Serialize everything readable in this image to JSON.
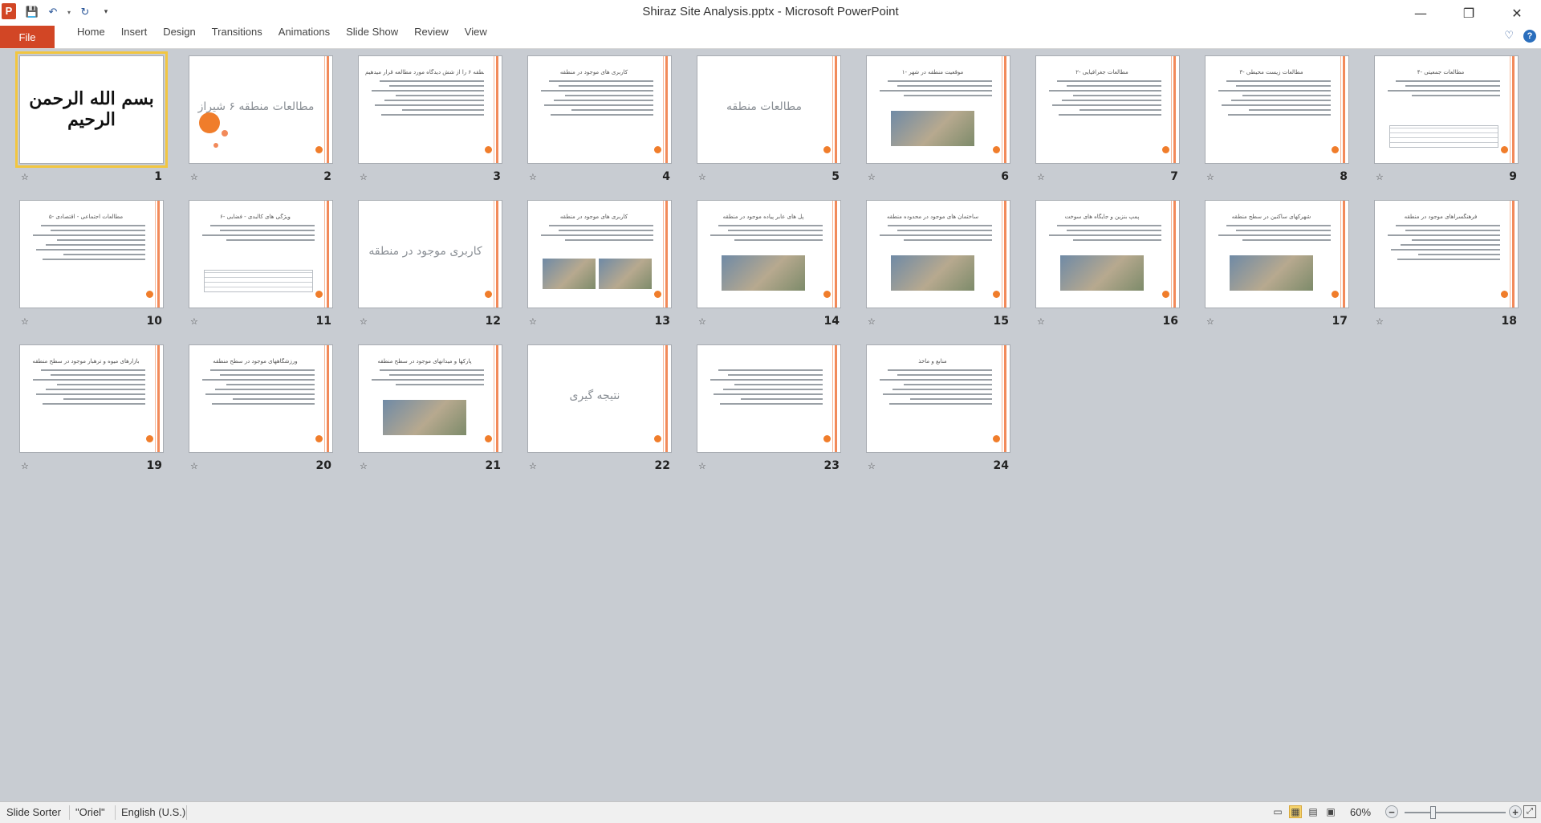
{
  "window": {
    "title": "Shiraz Site Analysis.pptx - Microsoft PowerPoint",
    "app_icon_letter": "P",
    "quick_access": [
      "save-icon",
      "undo-icon",
      "redo-icon",
      "customize-icon"
    ],
    "controls": {
      "minimize": "—",
      "restore": "❐",
      "close": "✕"
    }
  },
  "ribbon": {
    "file_label": "File",
    "tabs": [
      "Home",
      "Insert",
      "Design",
      "Transitions",
      "Animations",
      "Slide Show",
      "Review",
      "View"
    ],
    "help_label": "?"
  },
  "slides": [
    {
      "number": "1",
      "kind": "calligraphy",
      "title": "بسم الله الرحمن الرحیم"
    },
    {
      "number": "2",
      "kind": "title",
      "title": "مطالعات منطقه ۶ شیراز"
    },
    {
      "number": "3",
      "kind": "text",
      "title": "منطقه ۶ را از شش دیدگاه مورد مطالعه قرار میدهیم :"
    },
    {
      "number": "4",
      "kind": "text",
      "title": "کاربری های موجود در منطقه"
    },
    {
      "number": "5",
      "kind": "section",
      "title": "مطالعات منطقه"
    },
    {
      "number": "6",
      "kind": "photo",
      "title": "۱- موقعیت منطقه در شهر"
    },
    {
      "number": "7",
      "kind": "text",
      "title": "۲- مطالعات جغرافیایی"
    },
    {
      "number": "8",
      "kind": "text",
      "title": "۳- مطالعات زیست محیطی"
    },
    {
      "number": "9",
      "kind": "table",
      "title": "۴- مطالعات جمعیتی"
    },
    {
      "number": "10",
      "kind": "text",
      "title": "۵- مطالعات اجتماعی - اقتصادی"
    },
    {
      "number": "11",
      "kind": "table",
      "title": "۶- ویژگی های کالبدی - فضایی"
    },
    {
      "number": "12",
      "kind": "section",
      "title": "کاربری موجود در منطقه"
    },
    {
      "number": "13",
      "kind": "photo2",
      "title": "کاربری های موجود در منطقه"
    },
    {
      "number": "14",
      "kind": "photo",
      "title": "پل های عابر پیاده موجود در منطقه"
    },
    {
      "number": "15",
      "kind": "photo",
      "title": "ساختمان های موجود در محدوده منطقه"
    },
    {
      "number": "16",
      "kind": "photo",
      "title": "پمپ بنزین و جایگاه های سوخت"
    },
    {
      "number": "17",
      "kind": "photo",
      "title": "شهرکهای ساکنین در سطح منطقه"
    },
    {
      "number": "18",
      "kind": "text",
      "title": "فرهنگسراهای موجود در منطقه"
    },
    {
      "number": "19",
      "kind": "text",
      "title": "بازارهای میوه و ترهبار موجود در سطح منطقه"
    },
    {
      "number": "20",
      "kind": "text",
      "title": "ورزشگاههای موجود در سطح منطقه"
    },
    {
      "number": "21",
      "kind": "photo",
      "title": "پارکها و میدانهای موجود در سطح منطقه"
    },
    {
      "number": "22",
      "kind": "section",
      "title": "نتیجه گیری"
    },
    {
      "number": "23",
      "kind": "text",
      "title": ""
    },
    {
      "number": "24",
      "kind": "text",
      "title": "منابع و ماخذ"
    }
  ],
  "status": {
    "view_name": "Slide Sorter",
    "theme": "\"Oriel\"",
    "language": "English (U.S.)",
    "zoom": "60%",
    "zoom_level": 0.6
  }
}
